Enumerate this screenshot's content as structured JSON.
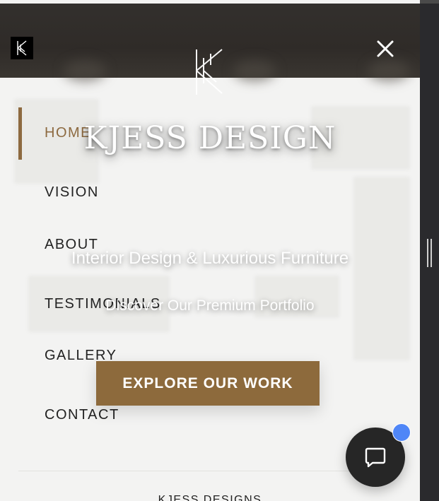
{
  "header": {
    "logo_icon": "kjess-monogram-icon",
    "close_icon": "close-icon"
  },
  "nav": {
    "items": [
      {
        "label": "HOME",
        "active": true
      },
      {
        "label": "VISION"
      },
      {
        "label": "ABOUT"
      },
      {
        "label": "TESTIMONIALS"
      },
      {
        "label": "GALLERY"
      },
      {
        "label": "CONTACT"
      }
    ]
  },
  "hero": {
    "title": "KJESS DESIGN",
    "subtitle": "Interior Design & Luxurious Furniture",
    "tagline": "Discover Our Premium Portfolio",
    "cta_label": "EXPLORE OUR WORK"
  },
  "footer": {
    "brand": "KJESS DESIGNS"
  },
  "chat": {
    "icon": "chat-bubble-icon",
    "badge_color": "#4f86f7"
  },
  "colors": {
    "accent": "#8d6a3c",
    "header_bg": "#302c29",
    "panel_bg": "#f3f3f2",
    "chat_bg": "#262626"
  }
}
